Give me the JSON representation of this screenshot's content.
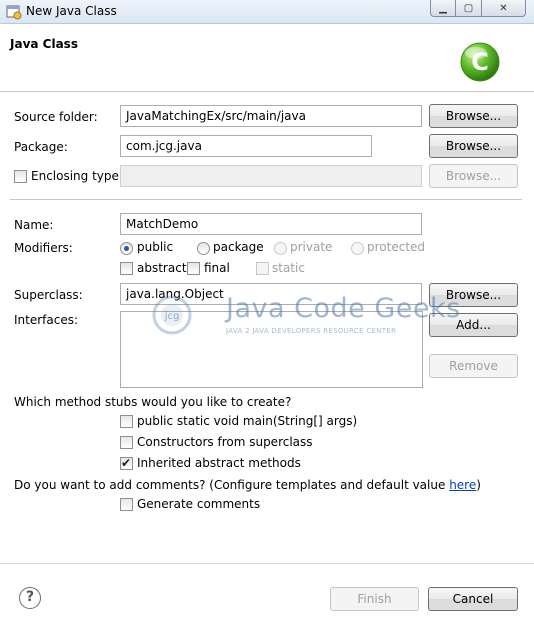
{
  "window": {
    "title": "New Java Class",
    "minimize_glyph": "▁",
    "maximize_glyph": "▢",
    "close_glyph": "✕"
  },
  "header": {
    "title": "Java Class",
    "logo_letter": "C"
  },
  "form": {
    "source_folder_label": "Source folder:",
    "source_folder_value": "JavaMatchingEx/src/main/java",
    "package_label": "Package:",
    "package_value": "com.jcg.java",
    "enclosing_type_label": "Enclosing type:",
    "enclosing_type_value": "",
    "browse_label": "Browse...",
    "name_label": "Name:",
    "name_value": "MatchDemo",
    "modifiers_label": "Modifiers:",
    "modifiers": {
      "public": "public",
      "package": "package",
      "private": "private",
      "protected": "protected",
      "abstract": "abstract",
      "final": "final",
      "static": "static",
      "selected": "public"
    },
    "superclass_label": "Superclass:",
    "superclass_value": "java.lang.Object",
    "interfaces_label": "Interfaces:",
    "add_label": "Add...",
    "remove_label": "Remove",
    "stubs_question": "Which method stubs would you like to create?",
    "stubs": {
      "main": "public static void main(String[] args)",
      "constructors": "Constructors from superclass",
      "inherited": "Inherited abstract methods"
    },
    "stubs_checked": {
      "main": false,
      "constructors": false,
      "inherited": true
    },
    "comments_question_prefix": "Do you want to add comments? (Configure templates and default value ",
    "comments_link": "here",
    "comments_question_suffix": ")",
    "generate_comments": "Generate comments"
  },
  "watermark": {
    "title": "Java Code Geeks",
    "subtitle": "JAVA 2 JAVA DEVELOPERS RESOURCE CENTER",
    "logo_text": "jcg"
  },
  "footer": {
    "help_glyph": "?",
    "finish_label": "Finish",
    "cancel_label": "Cancel"
  },
  "colors": {
    "logo_green": "#5cb82a",
    "watermark_blue": "#5078aa",
    "radio_dot": "#2a5aa8"
  }
}
